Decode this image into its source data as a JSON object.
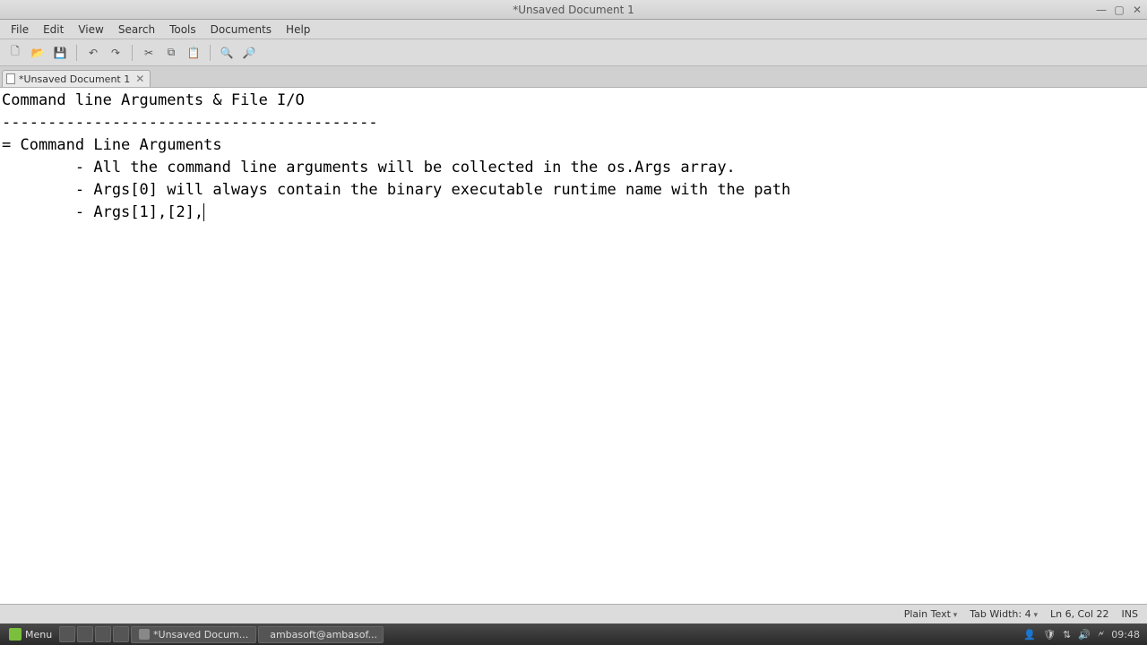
{
  "window": {
    "title": "*Unsaved Document 1"
  },
  "menu": {
    "file": "File",
    "edit": "Edit",
    "view": "View",
    "search": "Search",
    "tools": "Tools",
    "documents": "Documents",
    "help": "Help"
  },
  "tab": {
    "label": "*Unsaved Document 1"
  },
  "editor": {
    "line1": "Command line Arguments & File I/O",
    "line2": "-----------------------------------------",
    "line3": "= Command Line Arguments",
    "line4": "        - All the command line arguments will be collected in the os.Args array.",
    "line5": "        - Args[0] will always contain the binary executable runtime name with the path",
    "line6": "        - Args[1],[2],"
  },
  "status": {
    "syntax": "Plain Text",
    "tabwidth_label": "Tab Width:",
    "tabwidth_value": "4",
    "position": "Ln 6, Col 22",
    "mode": "INS"
  },
  "taskbar": {
    "menu": "Menu",
    "task1": "*Unsaved Docum...",
    "task2": "ambasoft@ambasof...",
    "time": "09:48"
  }
}
